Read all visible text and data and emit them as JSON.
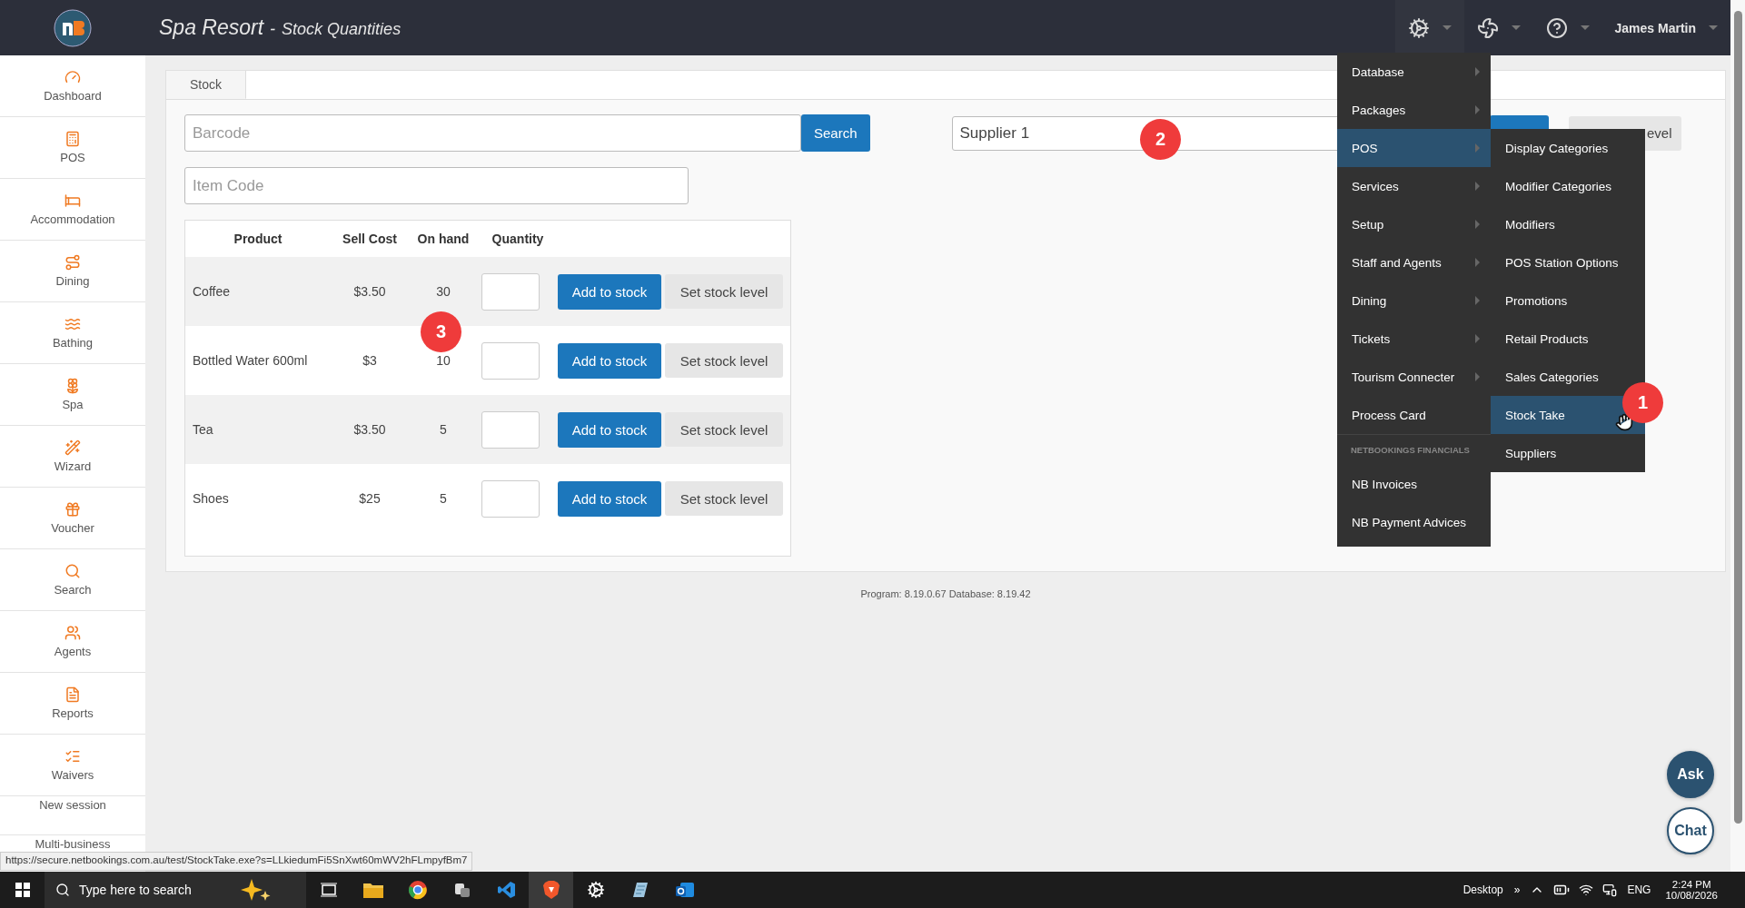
{
  "header": {
    "title": "Spa Resort",
    "separator": "-",
    "subtitle": "Stock Quantities",
    "user": "James Martin"
  },
  "sidebar": {
    "items": [
      {
        "label": "Dashboard"
      },
      {
        "label": "POS"
      },
      {
        "label": "Accommodation"
      },
      {
        "label": "Dining"
      },
      {
        "label": "Bathing"
      },
      {
        "label": "Spa"
      },
      {
        "label": "Wizard"
      },
      {
        "label": "Voucher"
      },
      {
        "label": "Search"
      },
      {
        "label": "Agents"
      },
      {
        "label": "Reports"
      },
      {
        "label": "Waivers"
      }
    ],
    "extra_items": [
      {
        "label": "New session"
      },
      {
        "label": "Multi-business"
      }
    ]
  },
  "tabs": [
    {
      "label": "Stock",
      "selected": true
    }
  ],
  "barcode": {
    "placeholder": "Barcode"
  },
  "search_button": "Search",
  "item_code": {
    "placeholder": "Item Code"
  },
  "supplier": {
    "value": "Supplier 1"
  },
  "covered_button": "evel",
  "table": {
    "columns": [
      "Product",
      "Sell Cost",
      "On hand",
      "Quantity"
    ],
    "rows": [
      {
        "product": "Coffee",
        "sell_cost": "$3.50",
        "on_hand": "30",
        "add": "Add to stock",
        "set": "Set stock level"
      },
      {
        "product": "Bottled Water 600ml",
        "sell_cost": "$3",
        "on_hand": "10",
        "add": "Add to stock",
        "set": "Set stock level"
      },
      {
        "product": "Tea",
        "sell_cost": "$3.50",
        "on_hand": "5",
        "add": "Add to stock",
        "set": "Set stock level"
      },
      {
        "product": "Shoes",
        "sell_cost": "$25",
        "on_hand": "5",
        "add": "Add to stock",
        "set": "Set stock level"
      }
    ]
  },
  "footer": "Program: 8.19.0.67 Database: 8.19.42",
  "menu": {
    "items": [
      {
        "kind": "item",
        "label": "Database",
        "submenu": true,
        "selected": false
      },
      {
        "kind": "item",
        "label": "Packages",
        "submenu": true,
        "selected": false
      },
      {
        "kind": "item",
        "label": "POS",
        "submenu": true,
        "selected": true
      },
      {
        "kind": "item",
        "label": "Services",
        "submenu": true,
        "selected": false
      },
      {
        "kind": "item",
        "label": "Setup",
        "submenu": true,
        "selected": false
      },
      {
        "kind": "item",
        "label": "Staff and Agents",
        "submenu": true,
        "selected": false
      },
      {
        "kind": "item",
        "label": "Dining",
        "submenu": true,
        "selected": false
      },
      {
        "kind": "item",
        "label": "Tickets",
        "submenu": true,
        "selected": false
      },
      {
        "kind": "item",
        "label": "Tourism Connecter",
        "submenu": true,
        "selected": false
      },
      {
        "kind": "item",
        "label": "Process Card",
        "submenu": false,
        "selected": false
      },
      {
        "kind": "header",
        "label": "NETBOOKINGS FINANCIALS"
      },
      {
        "kind": "item",
        "label": "NB Invoices",
        "submenu": false,
        "selected": false
      },
      {
        "kind": "item",
        "label": "NB Payment Advices",
        "submenu": false,
        "selected": false
      }
    ],
    "submenu": [
      {
        "label": "Display Categories",
        "selected": false
      },
      {
        "label": "Modifier Categories",
        "selected": false
      },
      {
        "label": "Modifiers",
        "selected": false
      },
      {
        "label": "POS Station Options",
        "selected": false
      },
      {
        "label": "Promotions",
        "selected": false
      },
      {
        "label": "Retail Products",
        "selected": false
      },
      {
        "label": "Sales Categories",
        "selected": false
      },
      {
        "label": "Stock Take",
        "selected": true
      },
      {
        "label": "Suppliers",
        "selected": false
      }
    ]
  },
  "annotations": [
    "1",
    "2",
    "3"
  ],
  "help": {
    "ask": "Ask",
    "chat": "Chat"
  },
  "status_url": "https://secure.netbookings.com.au/test/StockTake.exe?s=LLkiedumFi5SnXwt60mWV2hFLmpyfBm7",
  "taskbar": {
    "search_placeholder": "Type here to search",
    "desktop": "Desktop",
    "overflow": "»",
    "language": "ENG",
    "time": "2:24 PM",
    "date": "10/08/2026"
  }
}
